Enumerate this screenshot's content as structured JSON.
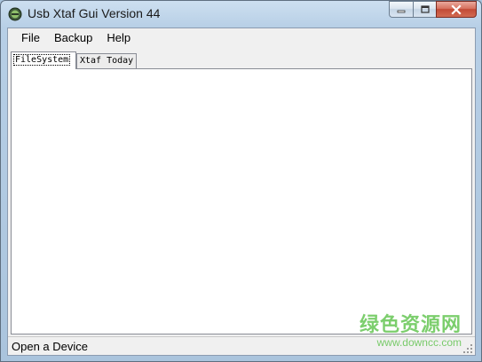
{
  "window": {
    "title": "Usb Xtaf Gui Version 44"
  },
  "caption_buttons": {
    "minimize_icon": "minimize-icon",
    "maximize_icon": "maximize-icon",
    "close_icon": "close-icon"
  },
  "menu": {
    "items": [
      {
        "label": "File"
      },
      {
        "label": "Backup"
      },
      {
        "label": "Help"
      }
    ]
  },
  "tabs": [
    {
      "label": "FileSystem",
      "selected": true
    },
    {
      "label": "Xtaf Today",
      "selected": false
    }
  ],
  "status": {
    "text": "Open a Device"
  },
  "watermark": {
    "brand": "绿色资源网",
    "url": "www.downcc.com"
  },
  "colors": {
    "close_button": "#c24a36",
    "watermark": "#50be3c"
  }
}
